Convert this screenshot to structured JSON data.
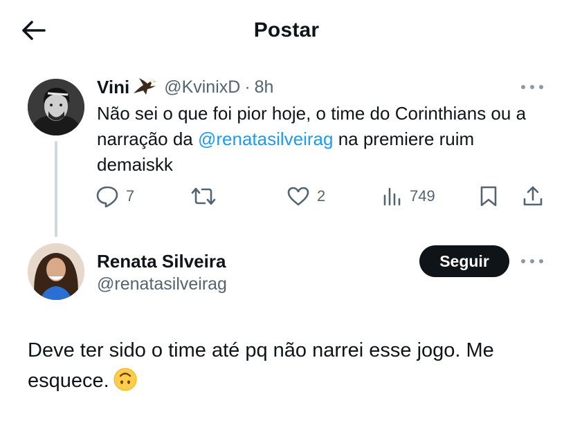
{
  "header": {
    "title": "Postar",
    "back_icon": "arrow-left-icon"
  },
  "tweet": {
    "author_name": "Vini",
    "author_badge_icon": "eagle-emoji-icon",
    "handle": "@KvinixD",
    "separator": "·",
    "time": "8h",
    "text_part1": "Não sei o que foi pior hoje, o time do Corinthians ou a narração da ",
    "mention": "@renatasilveirag",
    "text_part2": " na premiere ruim demaiskk",
    "replies": "7",
    "retweets": "",
    "likes": "2",
    "views": "749"
  },
  "reply": {
    "author_name": "Renata Silveira",
    "handle": "@renatasilveirag",
    "follow_label": "Seguir",
    "text": "Deve ter sido o time até pq não narrei esse jogo. Me esquece.",
    "emoji_icon": "upside-down-face-icon"
  },
  "colors": {
    "accent": "#1d9bf0",
    "text": "#0f1419",
    "secondary": "#536471",
    "follow_bg": "#0f1419"
  }
}
